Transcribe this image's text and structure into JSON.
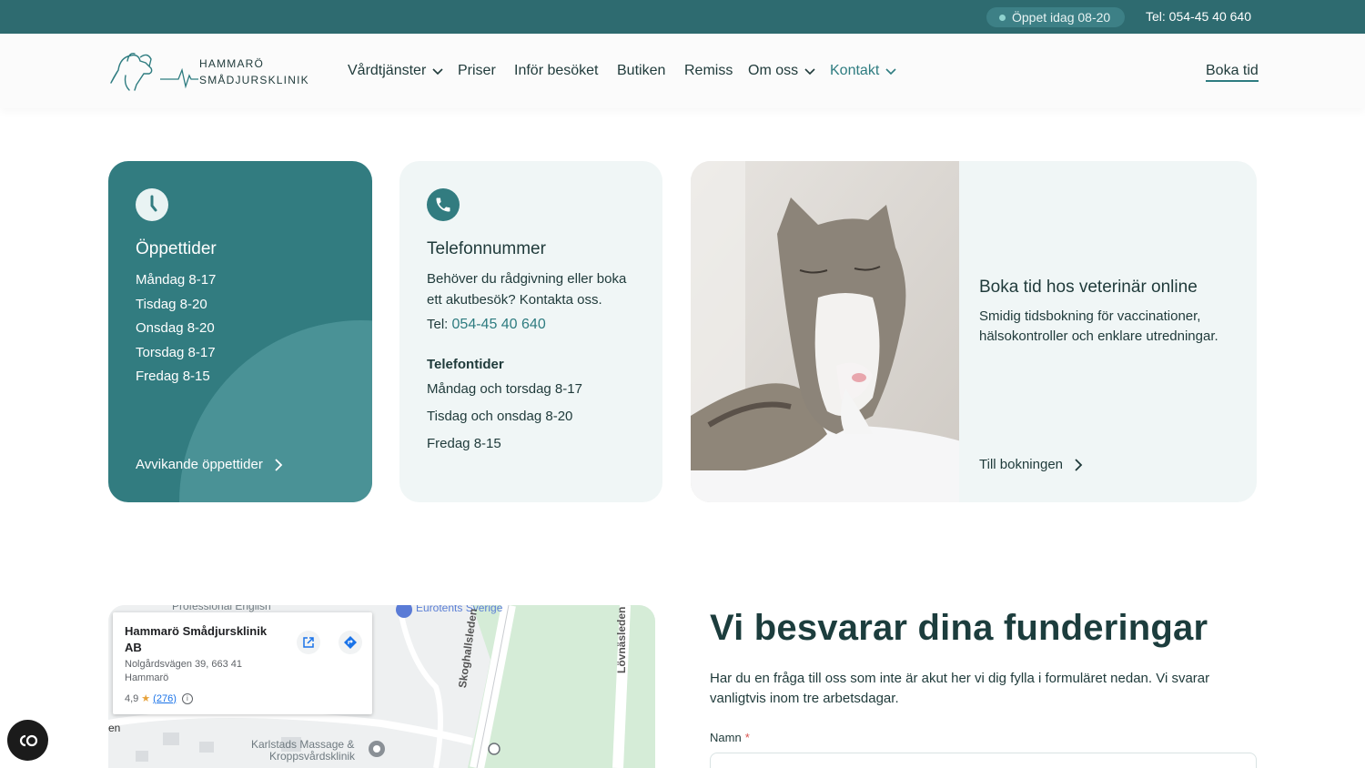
{
  "topbar": {
    "open_status": "Öppet idag 08-20",
    "phone": "Tel: 054-45 40 640"
  },
  "brand": {
    "line1": "HAMMARÖ",
    "line2": "SMÅDJURSKLINIK"
  },
  "nav": {
    "items": [
      {
        "label": "Vårdtjänster",
        "dropdown": true
      },
      {
        "label": "Priser",
        "dropdown": false
      },
      {
        "label": "Inför besöket",
        "dropdown": false
      },
      {
        "label": "Butiken",
        "dropdown": false
      },
      {
        "label": "Remiss",
        "dropdown": false
      },
      {
        "label": "Om oss",
        "dropdown": true
      },
      {
        "label": "Kontakt",
        "dropdown": true,
        "active": true
      }
    ],
    "cta": "Boka tid"
  },
  "hours_card": {
    "icon": "clock-icon",
    "title": "Öppettider",
    "days": [
      "Måndag 8-17",
      "Tisdag 8-20",
      "Onsdag 8-20",
      "Torsdag 8-17",
      "Fredag 8-15"
    ],
    "link": "Avvikande öppettider"
  },
  "phone_card": {
    "icon": "phone-icon",
    "title": "Telefonnummer",
    "desc": "Behöver du rådgivning eller boka ett akutbesök? Kontakta oss.",
    "tel_prefix": "Tel:",
    "tel_number": "054-45 40 640",
    "subtitle": "Telefontider",
    "times": [
      "Måndag och torsdag 8-17",
      "Tisdag och onsdag 8-20",
      "Fredag 8-15"
    ]
  },
  "booking_card": {
    "title": "Boka tid hos veterinär online",
    "desc": "Smidig tidsbokning för vaccinationer, hälsokontroller och enklare utredningar.",
    "link": "Till bokningen"
  },
  "map": {
    "place_name": "Hammarö Smådjursklinik AB",
    "address_line1": "Nolgårdsvägen 39, 663 41",
    "address_line2": "Hammarö",
    "rating": "4,9",
    "rating_count": "(276)",
    "labels": {
      "professional": "Professional English",
      "eurotents": "Eurotents Sverige",
      "skoghallsleden": "Skoghallsleden",
      "lovnasleden": "Lövnäsleden",
      "massage_1": "Karlstads Massage &",
      "massage_2": "Kroppsvårdsklinik",
      "en": "en"
    }
  },
  "contact": {
    "heading": "Vi besvarar dina funderingar",
    "desc": "Har du en fråga till oss som inte är akut her vi dig fylla i formuläret nedan. Vi svarar vanligtvis inom tre arbetsdagar.",
    "name_label": "Namn",
    "required_mark": "*"
  },
  "colors": {
    "topbar": "#2e6b70",
    "accent": "#327c80",
    "card_bg": "#f0f6f6"
  }
}
